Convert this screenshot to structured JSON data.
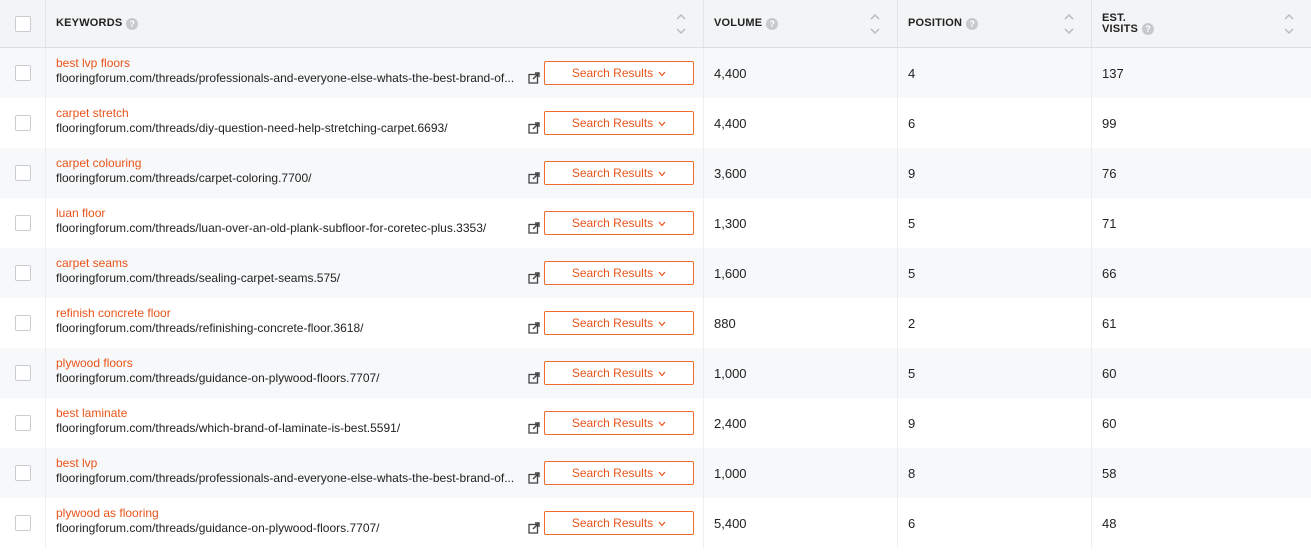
{
  "header": {
    "keywords": "KEYWORDS",
    "volume": "VOLUME",
    "position": "POSITION",
    "est_visits_line1": "EST.",
    "est_visits_line2": "VISITS",
    "help_glyph": "?"
  },
  "colors": {
    "accent": "#e8541a",
    "header_bg": "#f3f4f5",
    "row_alt_bg": "#f7f8f9"
  },
  "rows": [
    {
      "keyword": "best lvp floors",
      "url": "flooringforum.com/threads/professionals-and-everyone-else-whats-the-best-brand-of...",
      "button": "Search Results",
      "volume": "4,400",
      "position": "4",
      "visits": "137"
    },
    {
      "keyword": "carpet stretch",
      "url": "flooringforum.com/threads/diy-question-need-help-stretching-carpet.6693/",
      "button": "Search Results",
      "volume": "4,400",
      "position": "6",
      "visits": "99"
    },
    {
      "keyword": "carpet colouring",
      "url": "flooringforum.com/threads/carpet-coloring.7700/",
      "button": "Search Results",
      "volume": "3,600",
      "position": "9",
      "visits": "76"
    },
    {
      "keyword": "luan floor",
      "url": "flooringforum.com/threads/luan-over-an-old-plank-subfloor-for-coretec-plus.3353/",
      "button": "Search Results",
      "volume": "1,300",
      "position": "5",
      "visits": "71"
    },
    {
      "keyword": "carpet seams",
      "url": "flooringforum.com/threads/sealing-carpet-seams.575/",
      "button": "Search Results",
      "volume": "1,600",
      "position": "5",
      "visits": "66"
    },
    {
      "keyword": "refinish concrete floor",
      "url": "flooringforum.com/threads/refinishing-concrete-floor.3618/",
      "button": "Search Results",
      "volume": "880",
      "position": "2",
      "visits": "61"
    },
    {
      "keyword": "plywood floors",
      "url": "flooringforum.com/threads/guidance-on-plywood-floors.7707/",
      "button": "Search Results",
      "volume": "1,000",
      "position": "5",
      "visits": "60"
    },
    {
      "keyword": "best laminate",
      "url": "flooringforum.com/threads/which-brand-of-laminate-is-best.5591/",
      "button": "Search Results",
      "volume": "2,400",
      "position": "9",
      "visits": "60"
    },
    {
      "keyword": "best lvp",
      "url": "flooringforum.com/threads/professionals-and-everyone-else-whats-the-best-brand-of...",
      "button": "Search Results",
      "volume": "1,000",
      "position": "8",
      "visits": "58"
    },
    {
      "keyword": "plywood as flooring",
      "url": "flooringforum.com/threads/guidance-on-plywood-floors.7707/",
      "button": "Search Results",
      "volume": "5,400",
      "position": "6",
      "visits": "48"
    }
  ]
}
